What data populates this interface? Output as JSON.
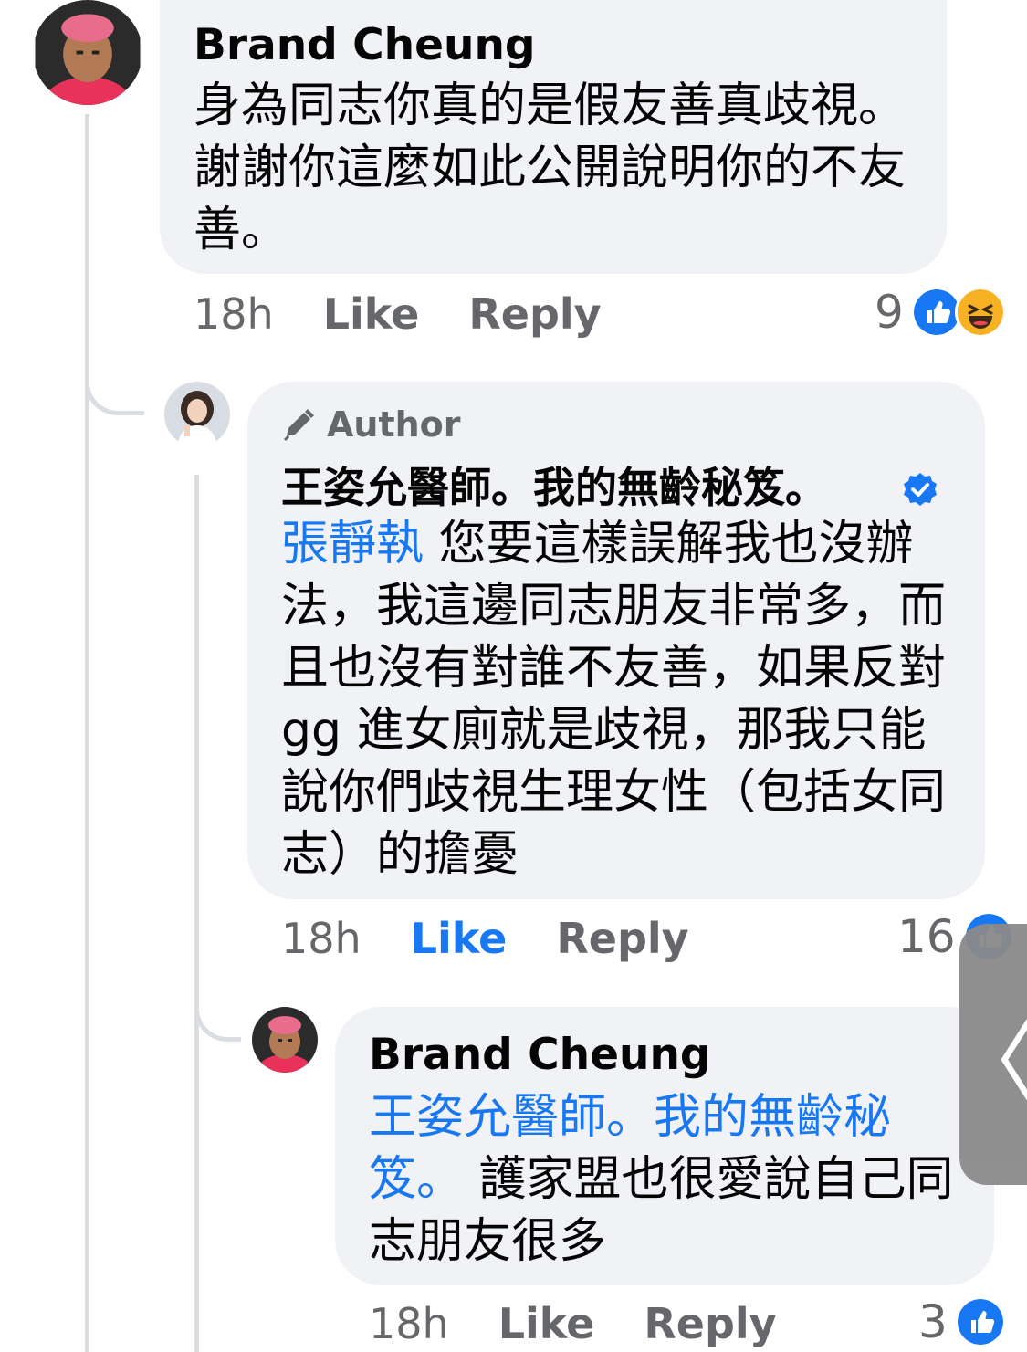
{
  "comments": [
    {
      "author": "Brand Cheung",
      "text": "身為同志你真的是假友善真歧視。謝謝你這麼如此公開說明你的不友善。",
      "time": "18h",
      "like_label": "Like",
      "reply_label": "Reply",
      "reaction_count": "9",
      "reactions": [
        "like-icon",
        "haha-icon"
      ]
    },
    {
      "badge": "Author",
      "author": "王姿允醫師。我的無齡秘笈。",
      "verified": true,
      "mention": "張靜執",
      "text": " 您要這樣誤解我也沒辦法，我這邊同志朋友非常多，而且也沒有對誰不友善，如果反對 gg 進女廁就是歧視，那我只能說你們歧視生理女性（包括女同志）的擔憂",
      "time": "18h",
      "like_label": "Like",
      "reply_label": "Reply",
      "reaction_count": "16",
      "reactions": [
        "like-icon"
      ]
    },
    {
      "author": "Brand Cheung",
      "mention": "王姿允醫師。我的無齡秘笈。",
      "text": " 護家盟也很愛說自己同志朋友很多",
      "time": "18h",
      "like_label": "Like",
      "reply_label": "Reply",
      "reaction_count": "3",
      "reactions": [
        "like-icon"
      ]
    }
  ],
  "side_handle": {
    "icon": "chevron-left-icon",
    "glyph": "〈"
  },
  "colors": {
    "bubble": "#f0f2f5",
    "secondary_text": "#65676b",
    "link": "#1877f2",
    "thread_line": "#dadde1"
  }
}
